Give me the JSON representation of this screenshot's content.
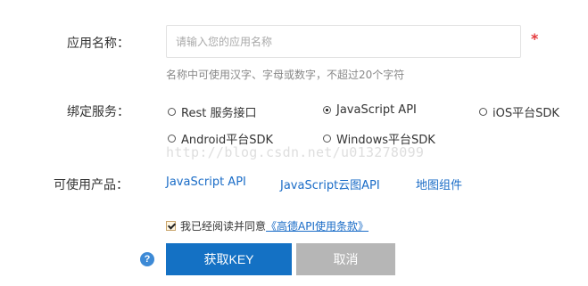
{
  "form": {
    "app_name": {
      "label": "应用名称：",
      "value": "",
      "placeholder": "请输入您的应用名称",
      "required_mark": "*",
      "hint": "名称中可使用汉字、字母或数字，不超过20个字符"
    },
    "services": {
      "label": "绑定服务：",
      "options": [
        {
          "label": "Rest 服务接口",
          "checked": false
        },
        {
          "label": "JavaScript API",
          "checked": true
        },
        {
          "label": "iOS平台SDK",
          "checked": false
        },
        {
          "label": "Android平台SDK",
          "checked": false
        },
        {
          "label": "Windows平台SDK",
          "checked": false
        }
      ]
    },
    "products": {
      "label": "可使用产品：",
      "links": [
        "JavaScript API",
        "JavaScript云图API",
        "地图组件"
      ]
    },
    "agreement": {
      "checked": true,
      "text": "我已经阅读并同意",
      "link": "《高德API使用条款》"
    },
    "buttons": {
      "help": "?",
      "submit": "获取KEY",
      "cancel": "取消"
    }
  },
  "watermark": "http://blog.csdn.net/u013278099",
  "colors": {
    "primary": "#1471c4",
    "link": "#1a6cc7",
    "required": "#e4393c",
    "disabled_button": "#b6b6b6"
  }
}
